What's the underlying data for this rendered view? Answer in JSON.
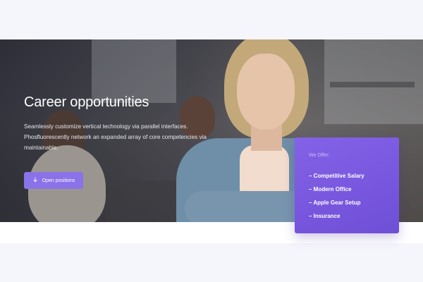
{
  "hero": {
    "title": "Career opportunities",
    "description": "Seamlessly customize vertical technology via parallel interfaces. Phosfluorescently network an expanded array of core competencies via maintainable.",
    "button_label": "Open positions",
    "button_icon": "arrow-down-icon"
  },
  "offer": {
    "heading": "We Offer:",
    "items": [
      "– Competitive Salary",
      "– Modern Office",
      "– Apple Gear Setup",
      "– Insurance"
    ]
  },
  "colors": {
    "accent": "#8a72e8",
    "card": "#7a58e2",
    "page_background": "#f5f6fb"
  }
}
